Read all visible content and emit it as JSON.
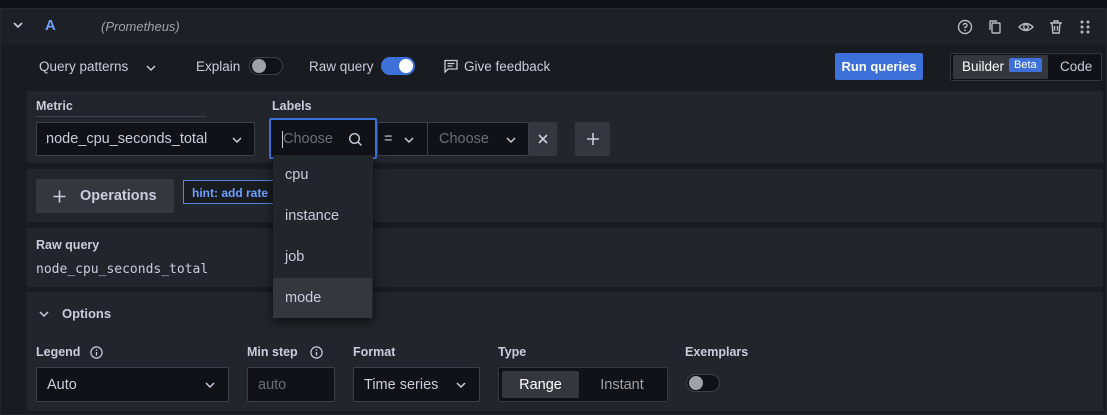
{
  "query": {
    "name": "A",
    "datasource": "(Prometheus)"
  },
  "toolbar": {
    "query_patterns": "Query patterns",
    "explain": "Explain",
    "raw_query": "Raw query",
    "give_feedback": "Give feedback",
    "run_queries": "Run queries",
    "builder": "Builder",
    "beta": "Beta",
    "code": "Code"
  },
  "metric": {
    "label": "Metric",
    "value": "node_cpu_seconds_total"
  },
  "labels": {
    "label": "Labels",
    "key_placeholder": "Choose",
    "operator": "=",
    "value_placeholder": "Choose"
  },
  "label_options": [
    {
      "label": "cpu"
    },
    {
      "label": "instance"
    },
    {
      "label": "job"
    },
    {
      "label": "mode"
    }
  ],
  "operations": {
    "button": "Operations",
    "hint": "hint: add rate"
  },
  "raw_query": {
    "label": "Raw query",
    "value": "node_cpu_seconds_total"
  },
  "options": {
    "title": "Options",
    "legend_label": "Legend",
    "legend_value": "Auto",
    "min_step_label": "Min step",
    "min_step_placeholder": "auto",
    "format_label": "Format",
    "format_value": "Time series",
    "type_label": "Type",
    "type_range": "Range",
    "type_instant": "Instant",
    "exemplars_label": "Exemplars"
  },
  "icons": {
    "help": "help-circle-icon",
    "duplicate": "copy-icon",
    "hide": "eye-icon",
    "delete": "trash-icon",
    "drag": "drag-handle-icon"
  }
}
